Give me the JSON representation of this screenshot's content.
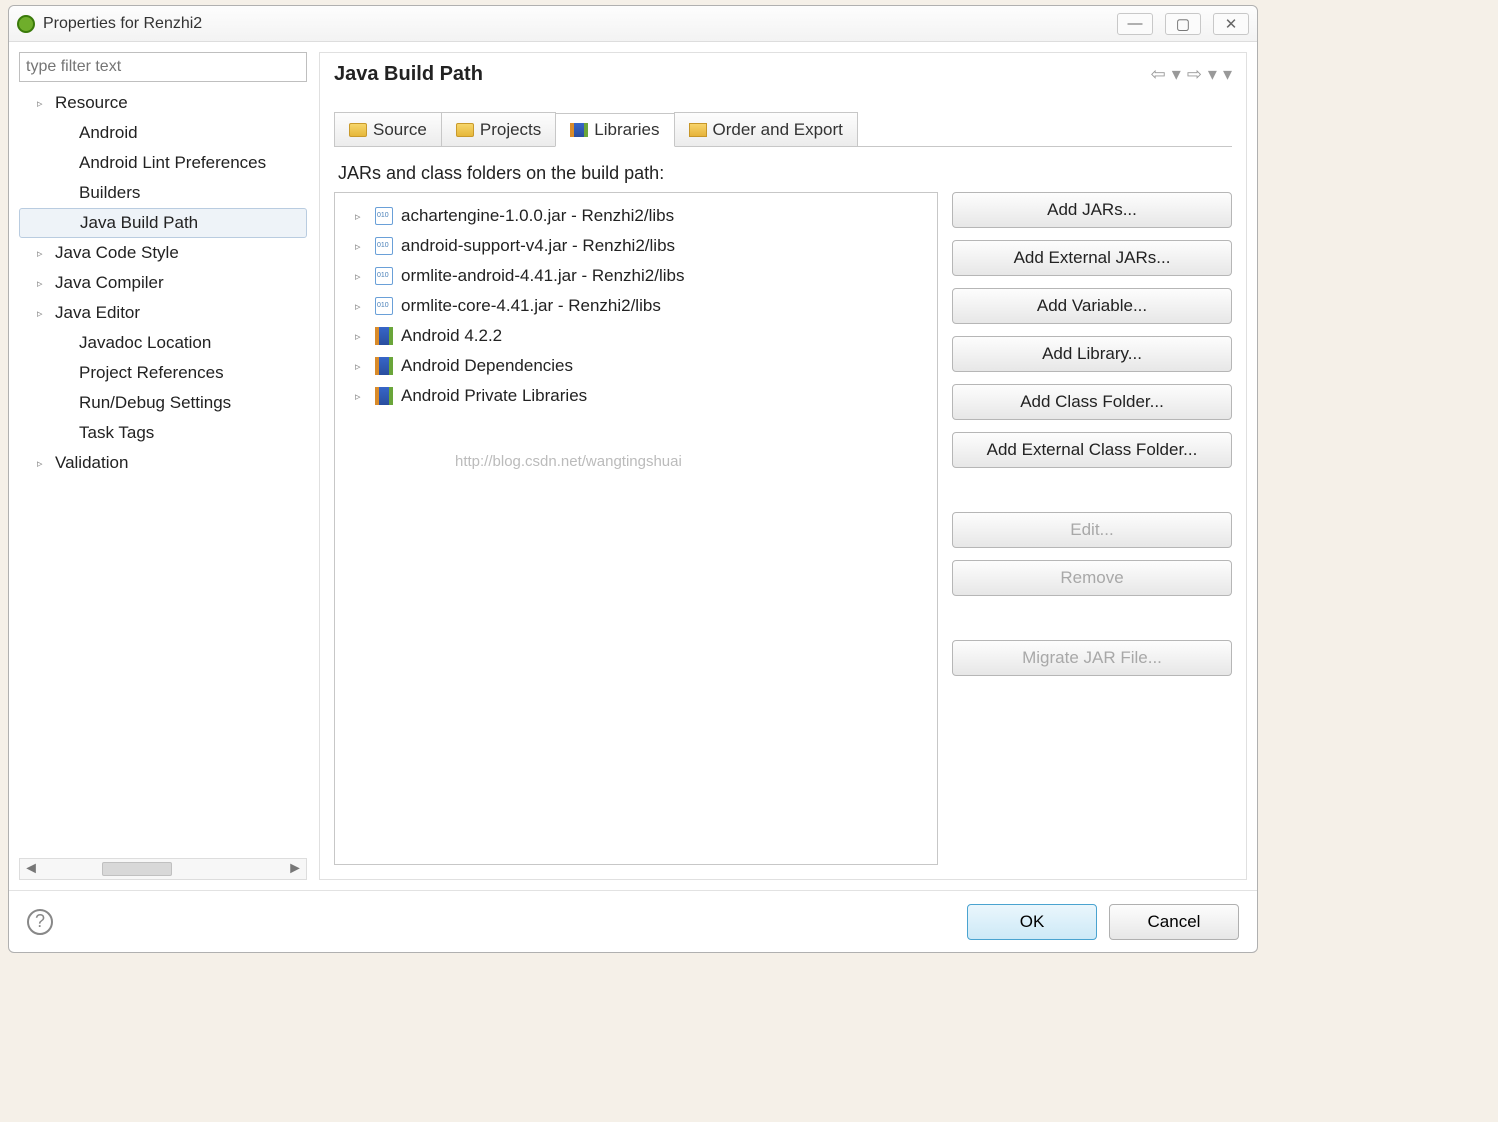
{
  "window": {
    "title": "Properties for Renzhi2"
  },
  "filter": {
    "placeholder": "type filter text"
  },
  "sidebar": {
    "items": [
      {
        "label": "Resource",
        "expandable": true,
        "child": false
      },
      {
        "label": "Android",
        "expandable": false,
        "child": true
      },
      {
        "label": "Android Lint Preferences",
        "expandable": false,
        "child": true
      },
      {
        "label": "Builders",
        "expandable": false,
        "child": true
      },
      {
        "label": "Java Build Path",
        "expandable": false,
        "child": true,
        "selected": true
      },
      {
        "label": "Java Code Style",
        "expandable": true,
        "child": false
      },
      {
        "label": "Java Compiler",
        "expandable": true,
        "child": false
      },
      {
        "label": "Java Editor",
        "expandable": true,
        "child": false
      },
      {
        "label": "Javadoc Location",
        "expandable": false,
        "child": true
      },
      {
        "label": "Project References",
        "expandable": false,
        "child": true
      },
      {
        "label": "Run/Debug Settings",
        "expandable": false,
        "child": true
      },
      {
        "label": "Task Tags",
        "expandable": false,
        "child": true
      },
      {
        "label": "Validation",
        "expandable": true,
        "child": false
      }
    ]
  },
  "page": {
    "title": "Java Build Path",
    "subtitle": "JARs and class folders on the build path:"
  },
  "tabs": [
    {
      "label": "Source",
      "icon": "folder"
    },
    {
      "label": "Projects",
      "icon": "folder"
    },
    {
      "label": "Libraries",
      "icon": "books",
      "active": true
    },
    {
      "label": "Order and Export",
      "icon": "export"
    }
  ],
  "libraries": [
    {
      "label": "achartengine-1.0.0.jar - Renzhi2/libs",
      "icon": "jar"
    },
    {
      "label": "android-support-v4.jar - Renzhi2/libs",
      "icon": "jar"
    },
    {
      "label": "ormlite-android-4.41.jar - Renzhi2/libs",
      "icon": "jar"
    },
    {
      "label": "ormlite-core-4.41.jar - Renzhi2/libs",
      "icon": "jar"
    },
    {
      "label": "Android 4.2.2",
      "icon": "books"
    },
    {
      "label": "Android Dependencies",
      "icon": "books"
    },
    {
      "label": "Android Private Libraries",
      "icon": "books"
    }
  ],
  "buttons": {
    "add_jars": "Add JARs...",
    "add_ext_jars": "Add External JARs...",
    "add_variable": "Add Variable...",
    "add_library": "Add Library...",
    "add_class_folder": "Add Class Folder...",
    "add_ext_class_folder": "Add External Class Folder...",
    "edit": "Edit...",
    "remove": "Remove",
    "migrate": "Migrate JAR File..."
  },
  "footer": {
    "ok": "OK",
    "cancel": "Cancel"
  },
  "watermark": "http://blog.csdn.net/wangtingshuai"
}
